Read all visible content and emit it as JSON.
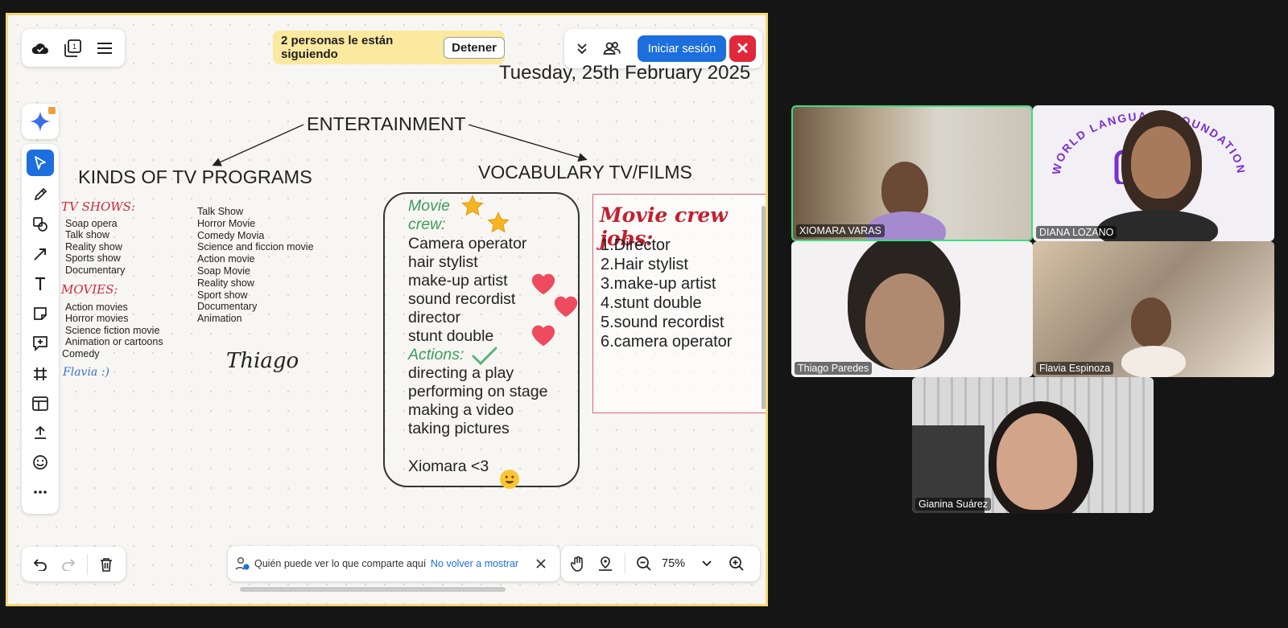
{
  "follow_banner": {
    "text": "2 personas le están siguiendo",
    "stop_label": "Detener"
  },
  "top_bar": {
    "login_label": "Iniciar sesión",
    "close_label": "✕",
    "page_badge": "1"
  },
  "board": {
    "date": "Tuesday, 25th February 2025",
    "entertainment_title": "ENTERTAINMENT",
    "kinds_title": "KINDS OF TV PROGRAMS",
    "vocab_title": "VOCABULARY TV/FILMS",
    "tvshows_label": "TV SHOWS:",
    "tvshows_items": [
      "Soap opera",
      "Talk show",
      "Reality show",
      "Sports show",
      "Documentary"
    ],
    "movies_label": "MOVIES:",
    "movies_items": [
      "Action movies",
      "Horror movies",
      "Science fiction movie",
      "Animation or cartoons"
    ],
    "movies_extra": "Comedy",
    "tvshows_list2": [
      "Talk Show",
      "Horror Movie",
      "Comedy Movia",
      "Science and ficcion movie",
      "Action movie",
      "Soap Movie",
      "Reality show",
      "Sport show",
      "Documentary",
      "Animation"
    ],
    "flavia_note": "Flavia :)",
    "thiago_note": "Thiago",
    "vocab_box": {
      "crew_label_1": "Movie",
      "crew_label_2": "crew:",
      "crew_items": [
        "Camera operator",
        "hair stylist",
        "make-up artist",
        "sound recordist",
        "director",
        "stunt double"
      ],
      "actions_label": "Actions:",
      "actions_items": [
        "directing a play",
        "performing on stage",
        "making a video",
        "taking pictures"
      ],
      "signature": "Xiomara <3"
    },
    "crew_jobs": {
      "title": "Movie crew jobs:",
      "items": [
        "1.Director",
        "2.Hair stylist",
        "3.make-up artist",
        "4.stunt double",
        "5.sound recordist",
        "6.camera operator"
      ]
    }
  },
  "bottom_bar": {
    "share_notice": "Quién puede ver lo que comparte aquí",
    "dont_show_again": "No volver a mostrar",
    "zoom_level": "75%"
  },
  "participants": [
    {
      "name": "XIOMARA VARAS"
    },
    {
      "name": "DIANA LOZANO"
    },
    {
      "name": "Thiago Paredes"
    },
    {
      "name": "Flavia Espinoza"
    },
    {
      "name": "Gianina Suárez"
    }
  ],
  "foundation_logo_text": "WORLD LANGUAGE FOUNDATION",
  "colors": {
    "accent": "#1c6fdc",
    "close": "#e0283a",
    "banner": "#fbe9a0",
    "active_speaker": "#3ddc84",
    "board_border": "#f7d878"
  }
}
